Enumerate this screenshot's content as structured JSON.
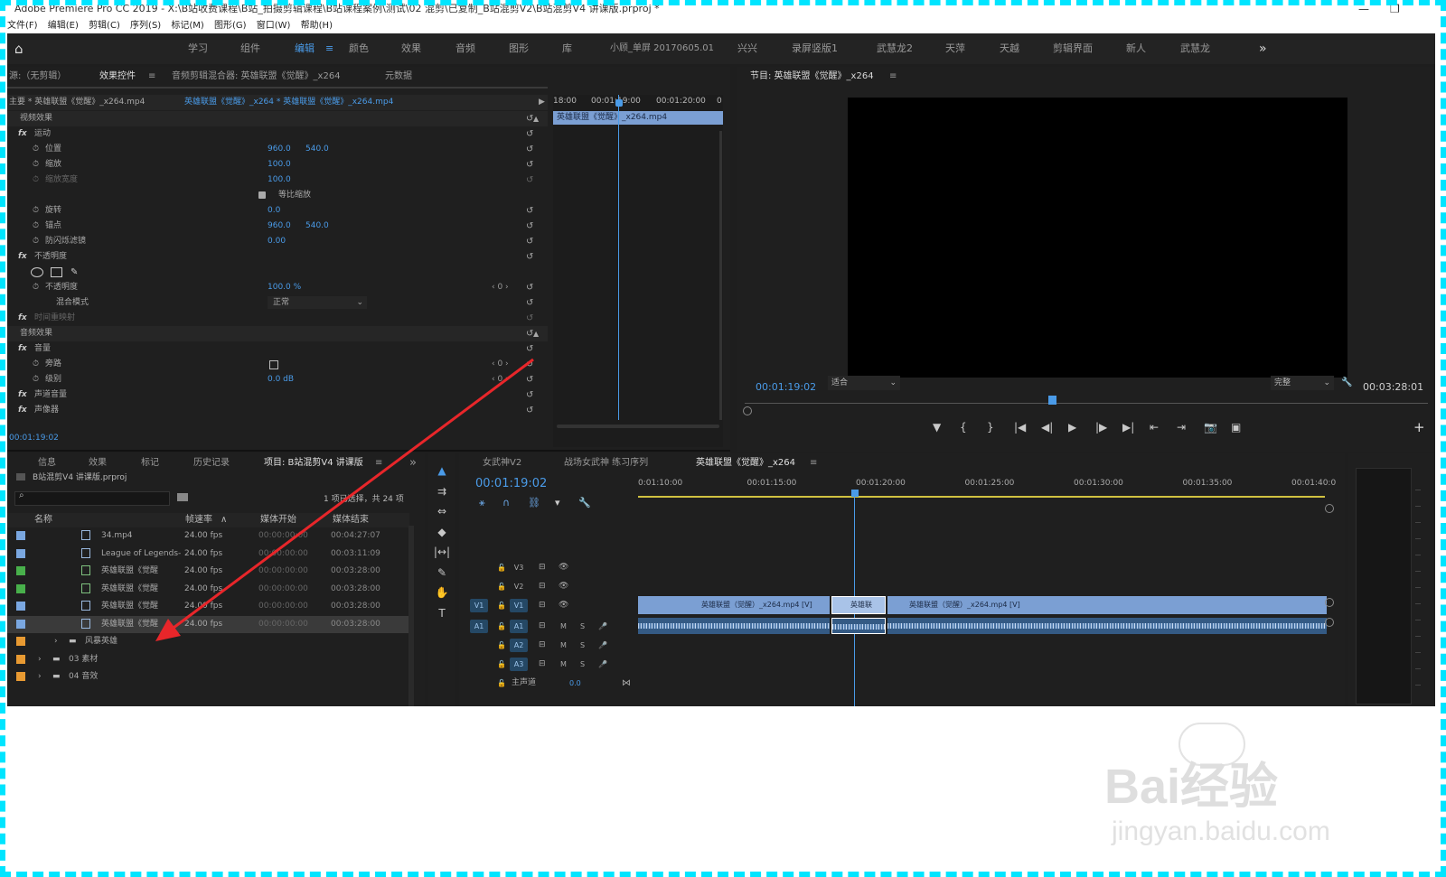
{
  "window": {
    "title": "Adobe Premiere Pro CC 2019 - X:\\B站收费课程\\B站_拍摄剪辑课程\\B站课程案例\\测试\\02 混剪\\已复制_B站混剪V2\\B站混剪V4 讲课版.prproj *",
    "min_glyph": "—",
    "max_glyph": "❐"
  },
  "menu": [
    "文件(F)",
    "编辑(E)",
    "剪辑(C)",
    "序列(S)",
    "标记(M)",
    "图形(G)",
    "窗口(W)",
    "帮助(H)"
  ],
  "workspaces": {
    "home_glyph": "⌂",
    "items": [
      "学习",
      "组件",
      "编辑",
      "颜色",
      "效果",
      "音频",
      "图形",
      "库",
      "小顾_单屏 20170605.01",
      "兴兴",
      "录屏竖版1",
      "武慧龙2",
      "天萍",
      "天越",
      "剪辑界面",
      "新人",
      "武慧龙"
    ],
    "active_marker": "≡",
    "more_glyph": "»"
  },
  "effect_controls": {
    "tabs": [
      "源:（无剪辑）",
      "效果控件",
      "音频剪辑混合器: 英雄联盟《觉醒》_x264",
      "元数据"
    ],
    "tab_menu": "≡",
    "master_label": "主要 * 英雄联盟《觉醒》_x264.mp4",
    "sequence_label": "英雄联盟《觉醒》_x264 * 英雄联盟《觉醒》_x264.mp4",
    "play_glyph": "▶",
    "video_effects_label": "视频效果",
    "fx_glyph": "fx",
    "motion_label": "运动",
    "position_label": "位置",
    "position_x": "960.0",
    "position_y": "540.0",
    "scale_label": "缩放",
    "scale_value": "100.0",
    "scale_width_label": "缩放宽度",
    "scale_width_value": "100.0",
    "uniform_label": "等比缩放",
    "rotation_label": "旋转",
    "rotation_value": "0.0",
    "anchor_label": "锚点",
    "anchor_x": "960.0",
    "anchor_y": "540.0",
    "flicker_label": "防闪烁滤镜",
    "flicker_value": "0.00",
    "opacity_section": "不透明度",
    "opacity_label": "不透明度",
    "opacity_value": "100.0 %",
    "blend_label": "混合模式",
    "blend_value": "正常",
    "time_remap_label": "时间重映射",
    "audio_effects_label": "音频效果",
    "volume_label": "音量",
    "bypass_label": "旁路",
    "level_label": "级别",
    "level_value": "0.0 dB",
    "keyframe_value": "0",
    "channel_volume_label": "声道音量",
    "panner_label": "声像器",
    "timecode": "00:01:19:02",
    "reset_glyph": "↺",
    "stopwatch_glyph": "⏱",
    "mini_ruler": [
      "18:00",
      "00:01:19:00",
      "00:01:20:00",
      "0"
    ],
    "mini_clip_label": "英雄联盟《觉醒》_x264.mp4"
  },
  "program": {
    "title": "节目: 英雄联盟《觉醒》_x264",
    "menu": "≡",
    "timecode": "00:01:19:02",
    "fit": "适合",
    "quality": "完整",
    "duration": "00:03:28:01",
    "wrench_glyph": "🔧",
    "add_glyph": "+",
    "controls": [
      "▼",
      "{",
      "}",
      "|◀",
      "◀|",
      "▶",
      "|▶",
      "▶|",
      "⇤",
      "⇥",
      "📷",
      "▣"
    ],
    "playhead_fraction": 0.45
  },
  "project": {
    "tabs": [
      "信息",
      "效果",
      "标记",
      "历史记录",
      "项目: B站混剪V4 讲课版"
    ],
    "tab_menu": "≡",
    "more_glyph": "»",
    "file_name": "B站混剪V4 讲课版.prproj",
    "selection_info": "1 项已选择，共 24 项",
    "columns": [
      "名称",
      "帧速率",
      "媒体开始",
      "媒体结束"
    ],
    "sort_glyph": "∧",
    "rows": [
      {
        "name": "34.mp4",
        "fps": "24.00 fps",
        "start": "00:00:00:00",
        "end": "00:04:27:07",
        "color": "#7aa7e0",
        "kind": "clip"
      },
      {
        "name": "League of Legends-",
        "fps": "24.00 fps",
        "start": "00:00:00:00",
        "end": "00:03:11:09",
        "color": "#7aa7e0",
        "kind": "clip"
      },
      {
        "name": "英雄联盟《觉醒",
        "fps": "24.00 fps",
        "start": "00:00:00:00",
        "end": "00:03:28:00",
        "color": "#48b04b",
        "kind": "seq"
      },
      {
        "name": "英雄联盟《觉醒",
        "fps": "24.00 fps",
        "start": "00:00:00:00",
        "end": "00:03:28:00",
        "color": "#48b04b",
        "kind": "seq"
      },
      {
        "name": "英雄联盟《觉醒",
        "fps": "24.00 fps",
        "start": "00:00:00:00",
        "end": "00:03:28:00",
        "color": "#7aa7e0",
        "kind": "clip"
      },
      {
        "name": "英雄联盟《觉醒",
        "fps": "24.00 fps",
        "start": "00:00:00:00",
        "end": "00:03:28:00",
        "color": "#7aa7e0",
        "kind": "clip"
      }
    ],
    "folders": [
      {
        "name": "风暴英雄",
        "color": "#e89a32"
      },
      {
        "name": "03 素材",
        "color": "#e89a32"
      },
      {
        "name": "04 音效",
        "color": "#e89a32"
      }
    ],
    "folder_glyph": "▬",
    "expand_glyph": "›"
  },
  "timeline": {
    "tabs": [
      "女武神V2",
      "战场女武神 练习序列",
      "英雄联盟《觉醒》_x264"
    ],
    "tab_menu": "≡",
    "timecode": "00:01:19:02",
    "ruler": [
      "0:01:10:00",
      "00:01:15:00",
      "00:01:20:00",
      "00:01:25:00",
      "00:01:30:00",
      "00:01:35:00",
      "00:01:40:0"
    ],
    "tracks": [
      "V3",
      "V2",
      "V1",
      "A1",
      "A2",
      "A3"
    ],
    "source_v": "V1",
    "source_a": "A1",
    "master_label": "主声道",
    "master_value": "0.0",
    "m_label": "M",
    "s_label": "S",
    "lock_glyph": "🔓",
    "eye_glyph": "👁",
    "mic_glyph": "🎤",
    "end_glyph": "⋈",
    "clip1_label": "英雄联盟（觉醒）_x264.mp4 [V]",
    "clip2_label": "英雄联",
    "clip3_label": "英雄联盟（觉醒）_x264.mp4 [V]",
    "tools": [
      "▲",
      "⇉",
      "⇔",
      "◆",
      "|↔|",
      "✎",
      "✋",
      "T"
    ]
  },
  "watermark": {
    "brand": "Bai经验",
    "domain": "jingyan.baidu.com"
  },
  "colors": {
    "accent": "#4a9be8",
    "clip_video": "#7b9fd3",
    "clip_audio": "#345a84",
    "annotation": "#e8262a",
    "border": "#00e5ff"
  }
}
